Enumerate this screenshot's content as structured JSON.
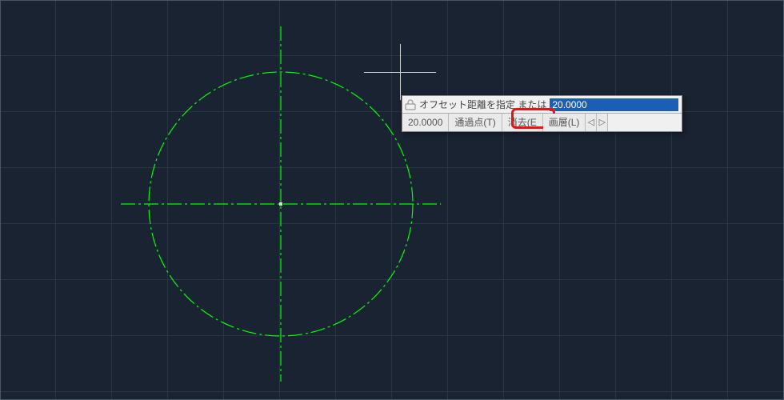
{
  "cad": {
    "prompt_label": "オフセット距離を指定 または",
    "input_value": "20.0000",
    "options": {
      "current": "20.0000",
      "through": "通過点(T)",
      "erase": "消去(E",
      "layer": "画層(L)"
    },
    "arrows": {
      "left": "◁",
      "right": "▷"
    },
    "colors": {
      "drawing": "#00ff00",
      "highlight_border": "#ee1111"
    },
    "geometry_description": "circle with center crosshair lines (dash-dot)"
  }
}
